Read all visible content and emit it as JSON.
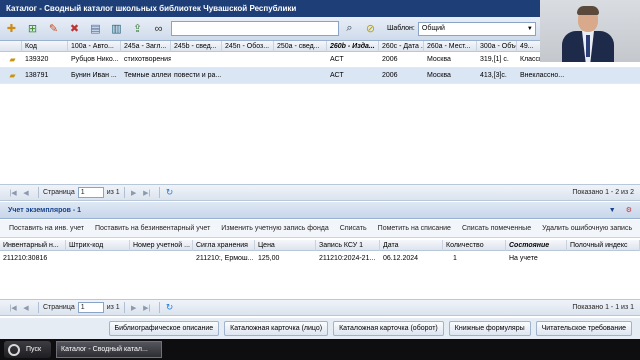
{
  "window": {
    "title": "Каталог - Сводный каталог школьных библиотек Чувашской Республики"
  },
  "toolbar": {
    "template_label": "Шаблон:",
    "template_value": "Общий",
    "icons": [
      "add-record-icon",
      "add-copy-icon",
      "edit-icon",
      "delete-icon",
      "books-icon",
      "export-icon",
      "binoculars-icon",
      "search-icon",
      "clear-filter-icon",
      "refresh-icon",
      "tools-icon"
    ]
  },
  "top_grid": {
    "columns": [
      "Код",
      "100a - Авто...",
      "245a - Загл...",
      "245b - свед...",
      "245n - Обоз...",
      "250a - свед...",
      "260b - Изда...",
      "260c - Дата ...",
      "260a - Мест...",
      "300a - Объём",
      "49..."
    ],
    "rows": [
      [
        "139320",
        "Рубцов Нико...",
        "стихотворения",
        "",
        "",
        "",
        "АСТ",
        "2006",
        "Москва",
        "319,[1] с.",
        "Классическ..."
      ],
      [
        "138791",
        "Бунин Иван ...",
        "Темные аллеи",
        "повести и ра...",
        "",
        "",
        "АСТ",
        "2006",
        "Москва",
        "413,[3]с.",
        "Внеклассно..."
      ]
    ]
  },
  "top_pager": {
    "page_label": "Страница",
    "page_value": "1",
    "of_label": "из 1",
    "info": "Показано 1 - 2 из 2"
  },
  "copies": {
    "section_title": "Учет экземпляров - 1",
    "actions": [
      "Поставить на инв. учет",
      "Поставить на безинвентарный учет",
      "Изменить учетную запись фонда",
      "Списать",
      "Пометить на списание",
      "Списать помеченные",
      "Удалить ошибочную запись"
    ],
    "columns": [
      "Инвентарный н...",
      "Штрих-код",
      "Номер учетной ...",
      "Сигла хранения",
      "Цена",
      "Запись КСУ 1",
      "Дата",
      "Количество",
      "Состояние",
      "Полочный индекс"
    ],
    "rows": [
      [
        "211210:30816",
        "",
        "",
        "211210:, Ермош...",
        "125,00",
        "211210:2024-21...",
        "06.12.2024",
        "1",
        "На учете",
        ""
      ]
    ]
  },
  "bottom_pager": {
    "page_label": "Страница",
    "page_value": "1",
    "of_label": "из 1",
    "info": "Показано 1 - 1 из 1"
  },
  "bottom_buttons": [
    "Библиографическое описание",
    "Каталожная карточка (лицо)",
    "Каталожная карточка (оборот)",
    "Книжные формуляры",
    "Читательское требование"
  ],
  "taskbar": {
    "start_label": "Пуск",
    "task_label": "Каталог - Сводный катал..."
  }
}
